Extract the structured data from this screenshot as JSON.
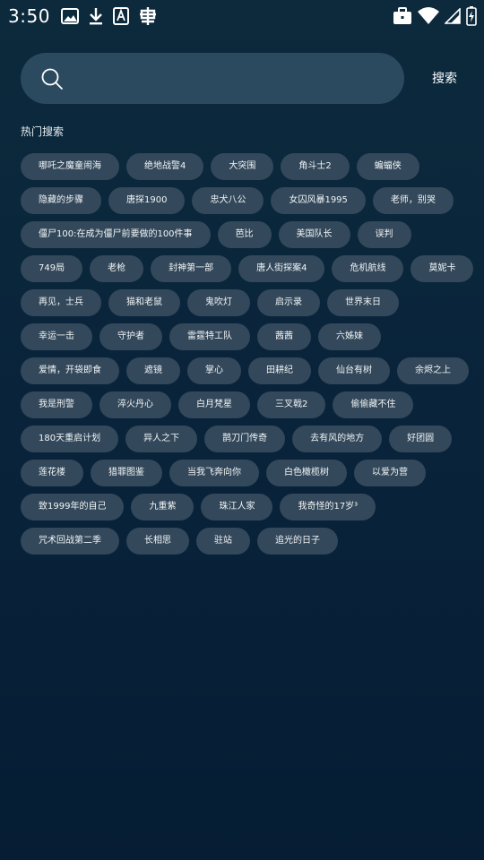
{
  "status_bar": {
    "time": "3:50"
  },
  "search": {
    "placeholder": "",
    "value": "",
    "button_label": "搜索"
  },
  "hot_search": {
    "title": "热门搜索",
    "rows": [
      [
        "哪吒之魔童闹海",
        "绝地战警4",
        "大突围",
        "角斗士2",
        "蝙蝠侠"
      ],
      [
        "隐藏的步骤",
        "唐探1900",
        "忠犬八公",
        "女囚风暴1995",
        "老师，别哭"
      ],
      [
        "僵尸100:在成为僵尸前要做的100件事",
        "芭比",
        "美国队长",
        "误判"
      ],
      [
        "749局",
        "老枪",
        "封神第一部",
        "唐人街探案4",
        "危机航线",
        "莫妮卡"
      ],
      [
        "再见，士兵",
        "猫和老鼠",
        "鬼吹灯",
        "启示录",
        "世界末日"
      ],
      [
        "幸运一击",
        "守护者",
        "雷霆特工队",
        "茜茜",
        "六姊妹"
      ],
      [
        "爱情，开袋即食",
        "遮镜",
        "掌心",
        "田耕纪",
        "仙台有树",
        "余烬之上"
      ],
      [
        "我是刑警",
        "淬火丹心",
        "白月梵星",
        "三叉戟2",
        "偷偷藏不住"
      ],
      [
        "180天重启计划",
        "异人之下",
        "鹊刀门传奇",
        "去有风的地方",
        "好团圆"
      ],
      [
        "莲花楼",
        "猎罪图鉴",
        "当我飞奔向你",
        "白色橄榄树",
        "以爱为营"
      ],
      [
        "致1999年的自己",
        "九重紫",
        "珠江人家",
        "我奇怪的17岁³"
      ],
      [
        "咒术回战第二季",
        "长相思",
        "驻站",
        "追光的日子"
      ]
    ]
  }
}
